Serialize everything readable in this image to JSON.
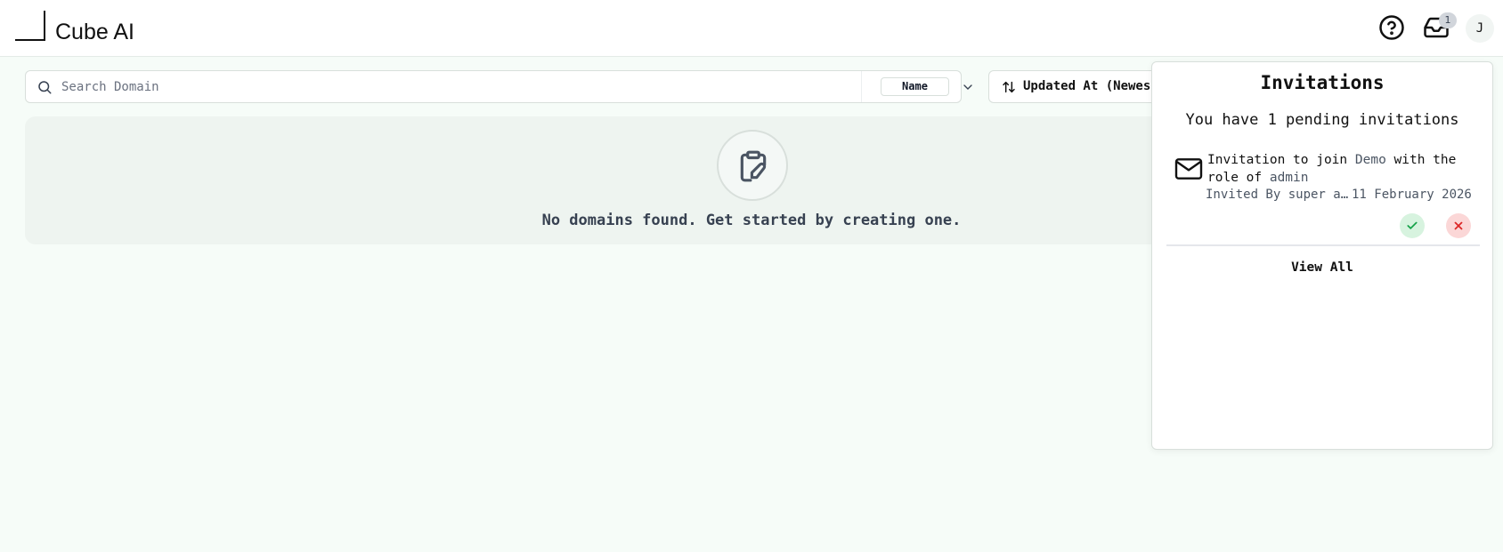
{
  "app": {
    "brand": "Cube AI"
  },
  "header": {
    "help_icon": "help-circle-icon",
    "inbox_icon": "inbox-icon",
    "notification_count": "1",
    "avatar_initial": "J"
  },
  "search": {
    "placeholder": "Search Domain",
    "value": "",
    "filter_selected": "Name"
  },
  "sort": {
    "label": "Updated At (Newest"
  },
  "empty_state": {
    "icon": "clipboard-pen-icon",
    "message": "No domains found. Get started by creating one."
  },
  "invitations": {
    "title": "Invitations",
    "subtitle": "You have 1 pending invitations",
    "items": [
      {
        "icon": "mail-icon",
        "prefix": "Invitation to join",
        "domain": "Demo",
        "middle": "with the role of",
        "role": "admin",
        "invited_by": "Invited By super admin",
        "date": "11 February 2026"
      }
    ],
    "view_all": "View All"
  },
  "colors": {
    "page_bg": "#f6fcf8",
    "accept_bg": "#d7f3df",
    "accept_icon": "#16a34a",
    "decline_bg": "#fbd7d7",
    "decline_icon": "#dc2626"
  }
}
